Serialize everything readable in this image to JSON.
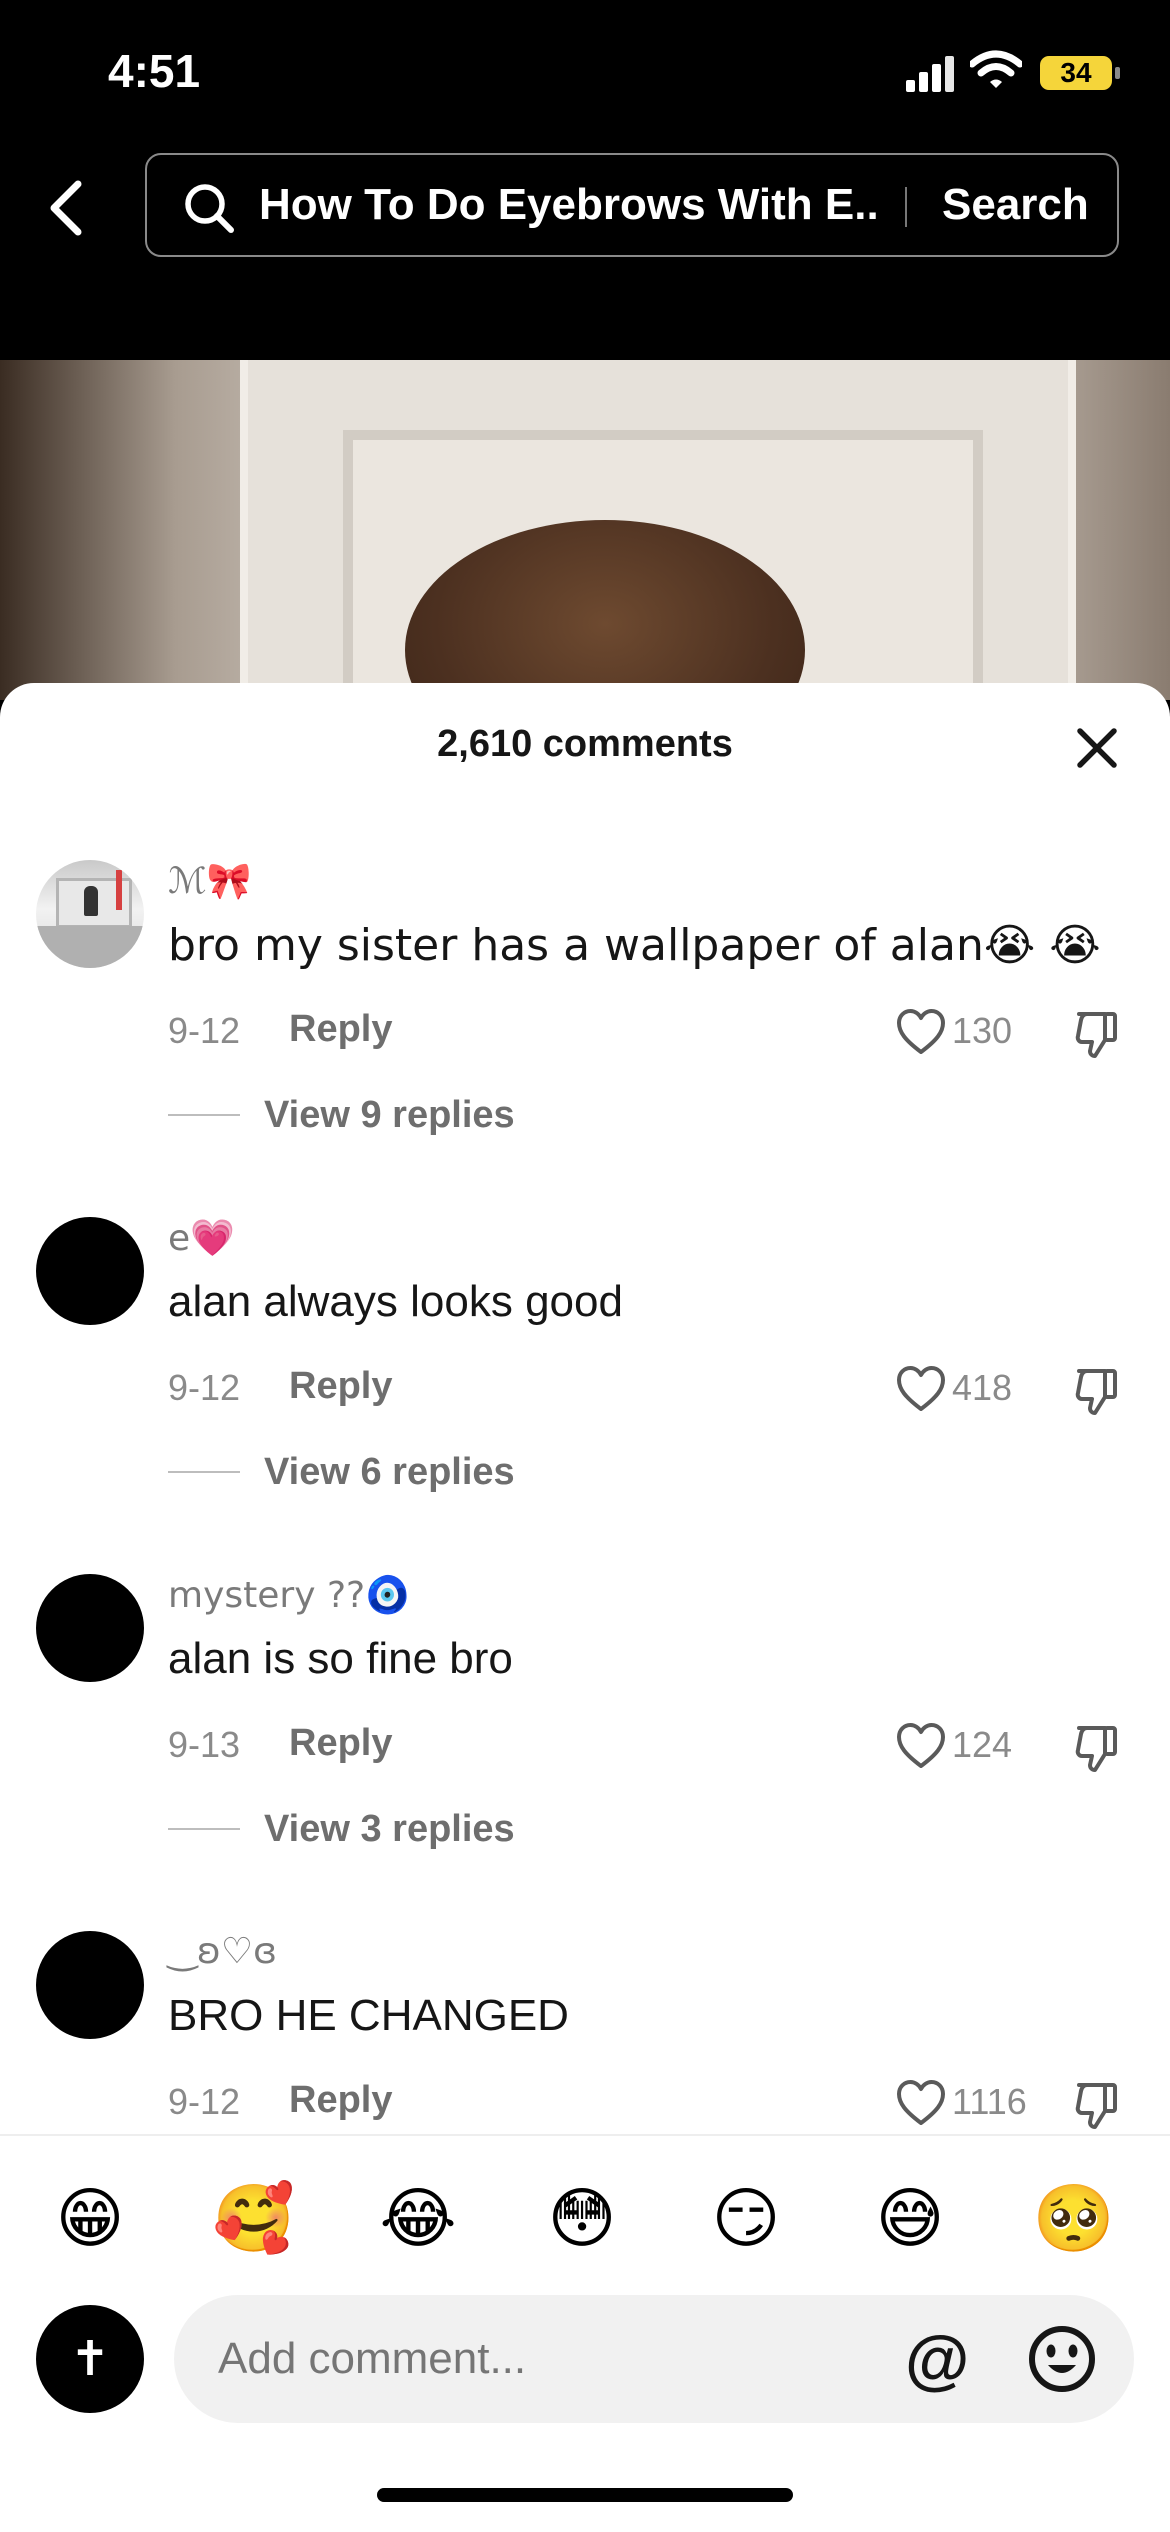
{
  "status_bar": {
    "time": "4:51",
    "battery": "34"
  },
  "search": {
    "query": "How To Do Eyebrows With E...",
    "button": "Search"
  },
  "comments_header": {
    "count_label": "2,610 comments"
  },
  "comments": [
    {
      "username": "ℳ🎀",
      "text": "bro my sister has a wallpaper of alan😭 😭",
      "date": "9-12",
      "reply": "Reply",
      "likes": "130",
      "view_replies": "View 9 replies"
    },
    {
      "username": "e💗",
      "text": "alan always looks good",
      "date": "9-12",
      "reply": "Reply",
      "likes": "418",
      "view_replies": "View 6 replies"
    },
    {
      "username": "mystery ??🧿",
      "text": "alan is so fine bro",
      "date": "9-13",
      "reply": "Reply",
      "likes": "124",
      "view_replies": "View 3 replies"
    },
    {
      "username": "‿ʚ♡ɞ",
      "text": "BRO HE CHANGED",
      "date": "9-12",
      "reply": "Reply",
      "likes": "1116"
    }
  ],
  "emoji_bar": [
    "😁",
    "🥰",
    "😂",
    "😳",
    "😏",
    "😅",
    "🥺"
  ],
  "composer": {
    "avatar_symbol": "✝",
    "placeholder": "Add comment...",
    "mention": "@"
  },
  "colors": {
    "sheet": "#ffffff",
    "text": "#161616",
    "muted": "#8a8a8a",
    "battery": "#f5d53a"
  },
  "icons": [
    "back-arrow-icon",
    "search-icon",
    "close-icon",
    "heart-icon",
    "dislike-icon",
    "smiley-icon",
    "signal-icon",
    "wifi-icon"
  ]
}
